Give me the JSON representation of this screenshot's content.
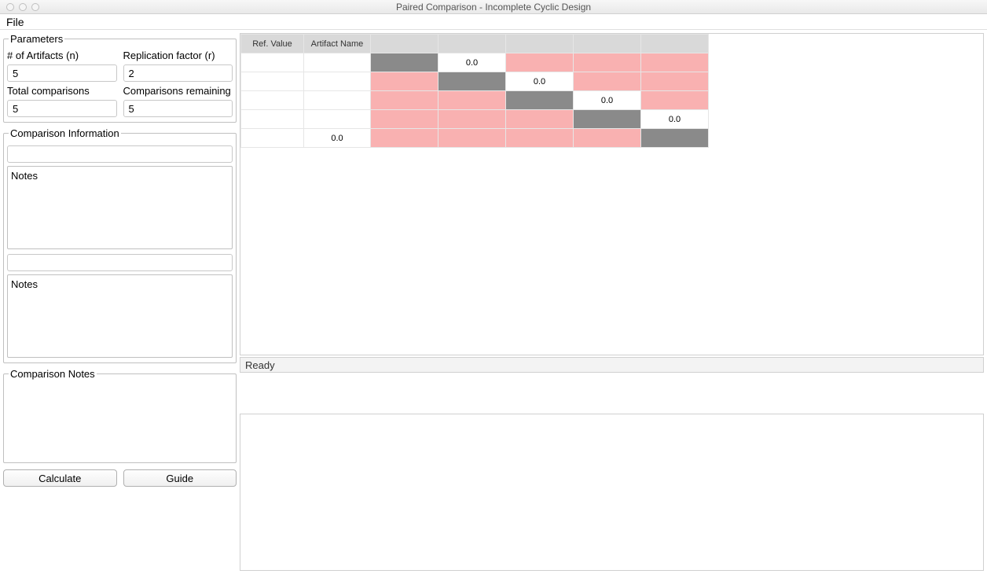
{
  "window": {
    "title": "Paired Comparison - Incomplete Cyclic Design"
  },
  "menu": {
    "file": "File"
  },
  "parameters": {
    "legend": "Parameters",
    "artifacts_label": "# of Artifacts (n)",
    "artifacts_value": "5",
    "replication_label": "Replication factor (r)",
    "replication_value": "2",
    "total_label": "Total comparisons",
    "total_value": "5",
    "remaining_label": "Comparisons remaining",
    "remaining_value": "5"
  },
  "comparison_info": {
    "legend": "Comparison Information",
    "input_value": "",
    "notes1_label": "Notes",
    "notes1_value": "",
    "mid_value": "",
    "notes2_label": "Notes",
    "notes2_value": ""
  },
  "comparison_notes": {
    "legend": "Comparison Notes",
    "value": ""
  },
  "buttons": {
    "calculate": "Calculate",
    "guide": "Guide"
  },
  "table": {
    "headers": {
      "ref_value": "Ref. Value",
      "artifact_name": "Artifact Name"
    },
    "rows": [
      {
        "ref": "",
        "name": "",
        "cells": [
          {
            "cls": "grey",
            "v": ""
          },
          {
            "cls": "white",
            "v": "0.0"
          },
          {
            "cls": "pink",
            "v": ""
          },
          {
            "cls": "pink",
            "v": ""
          },
          {
            "cls": "pink",
            "v": ""
          }
        ]
      },
      {
        "ref": "",
        "name": "",
        "cells": [
          {
            "cls": "pink",
            "v": ""
          },
          {
            "cls": "grey",
            "v": ""
          },
          {
            "cls": "white",
            "v": "0.0"
          },
          {
            "cls": "pink",
            "v": ""
          },
          {
            "cls": "pink",
            "v": ""
          }
        ]
      },
      {
        "ref": "",
        "name": "",
        "cells": [
          {
            "cls": "pink",
            "v": ""
          },
          {
            "cls": "pink",
            "v": ""
          },
          {
            "cls": "grey",
            "v": ""
          },
          {
            "cls": "white",
            "v": "0.0"
          },
          {
            "cls": "pink",
            "v": ""
          }
        ]
      },
      {
        "ref": "",
        "name": "",
        "cells": [
          {
            "cls": "pink",
            "v": ""
          },
          {
            "cls": "pink",
            "v": ""
          },
          {
            "cls": "pink",
            "v": ""
          },
          {
            "cls": "grey",
            "v": ""
          },
          {
            "cls": "white",
            "v": "0.0"
          }
        ]
      },
      {
        "ref": "",
        "name": "0.0",
        "cells": [
          {
            "cls": "pink",
            "v": ""
          },
          {
            "cls": "pink",
            "v": ""
          },
          {
            "cls": "pink",
            "v": ""
          },
          {
            "cls": "pink",
            "v": ""
          },
          {
            "cls": "grey",
            "v": ""
          }
        ]
      }
    ]
  },
  "status": {
    "text": "Ready"
  }
}
